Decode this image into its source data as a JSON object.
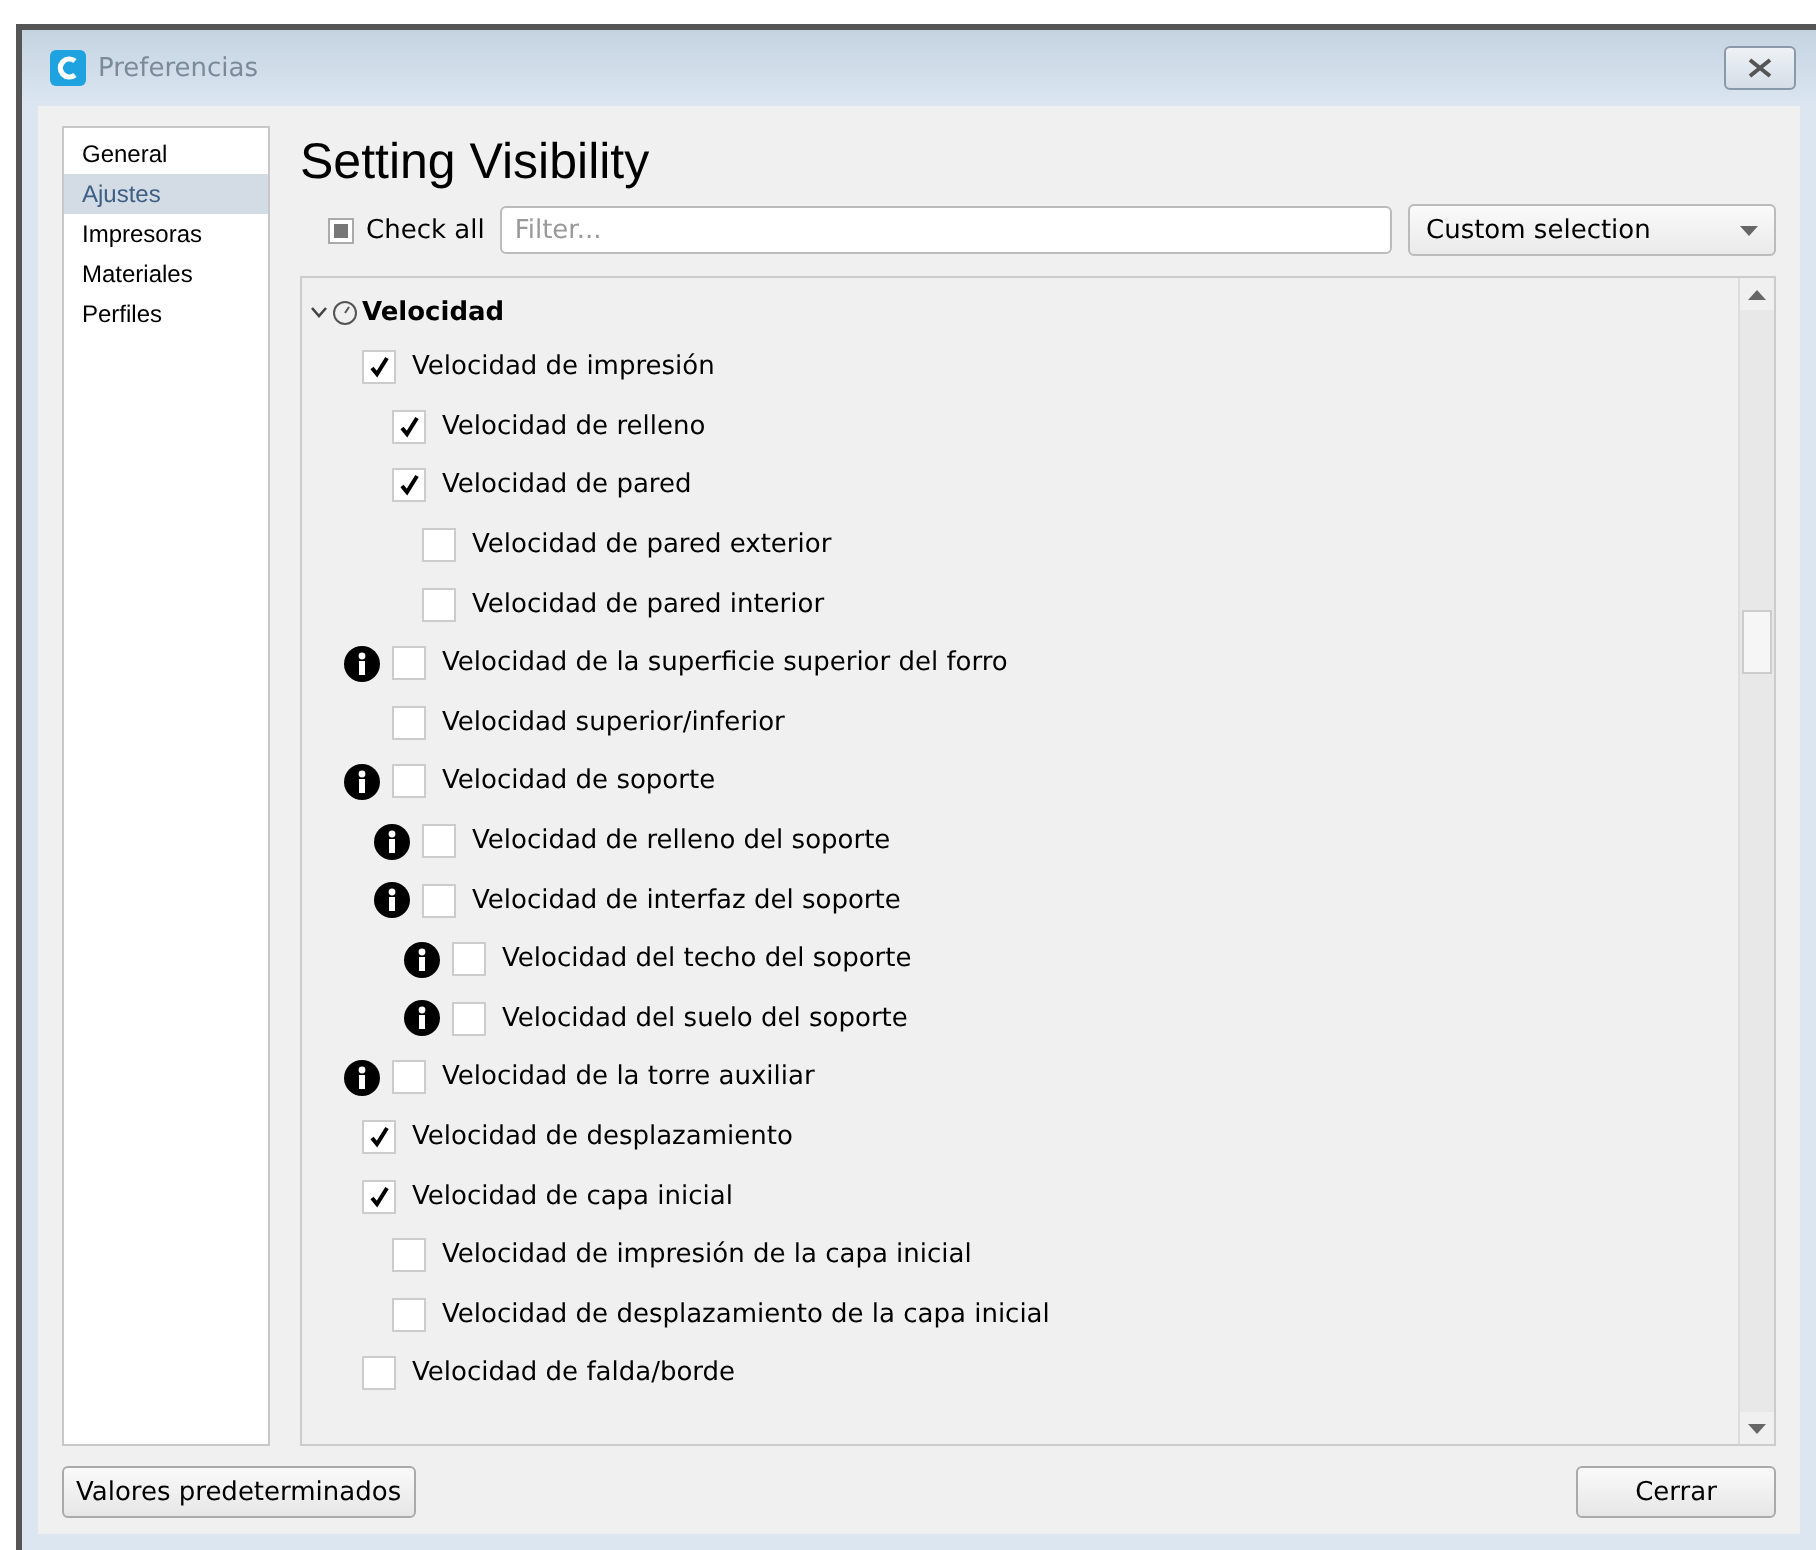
{
  "window": {
    "title": "Preferencias"
  },
  "sidebar": {
    "items": [
      {
        "label": "General",
        "selected": false
      },
      {
        "label": "Ajustes",
        "selected": true
      },
      {
        "label": "Impresoras",
        "selected": false
      },
      {
        "label": "Materiales",
        "selected": false
      },
      {
        "label": "Perfiles",
        "selected": false
      }
    ]
  },
  "heading": "Setting Visibility",
  "check_all": {
    "label": "Check all",
    "checked": false
  },
  "filter": {
    "placeholder": "Filter..."
  },
  "preset": {
    "value": "Custom selection"
  },
  "category": {
    "label": "Velocidad",
    "expanded": true,
    "children": [
      {
        "label": "Velocidad de impresión",
        "checked": true,
        "info": false,
        "children": [
          {
            "label": "Velocidad de relleno",
            "checked": true,
            "info": false
          },
          {
            "label": "Velocidad de pared",
            "checked": true,
            "info": false,
            "children": [
              {
                "label": "Velocidad de pared exterior",
                "checked": false,
                "info": false
              },
              {
                "label": "Velocidad de pared interior",
                "checked": false,
                "info": false
              }
            ]
          },
          {
            "label": "Velocidad de la superficie superior del forro",
            "checked": false,
            "info": true
          },
          {
            "label": "Velocidad superior/inferior",
            "checked": false,
            "info": false
          },
          {
            "label": "Velocidad de soporte",
            "checked": false,
            "info": true,
            "children": [
              {
                "label": "Velocidad de relleno del soporte",
                "checked": false,
                "info": true
              },
              {
                "label": "Velocidad de interfaz del soporte",
                "checked": false,
                "info": true,
                "children": [
                  {
                    "label": "Velocidad del techo del soporte",
                    "checked": false,
                    "info": true
                  },
                  {
                    "label": "Velocidad del suelo del soporte",
                    "checked": false,
                    "info": true
                  }
                ]
              }
            ]
          },
          {
            "label": "Velocidad de la torre auxiliar",
            "checked": false,
            "info": true
          }
        ]
      },
      {
        "label": "Velocidad de desplazamiento",
        "checked": true,
        "info": false
      },
      {
        "label": "Velocidad de capa inicial",
        "checked": true,
        "info": false,
        "children": [
          {
            "label": "Velocidad de impresión de la capa inicial",
            "checked": false,
            "info": false
          },
          {
            "label": "Velocidad de desplazamiento de la capa inicial",
            "checked": false,
            "info": false
          }
        ]
      },
      {
        "label": "Velocidad de falda/borde",
        "checked": false,
        "info": false
      }
    ]
  },
  "buttons": {
    "defaults": "Valores predeterminados",
    "close": "Cerrar"
  }
}
